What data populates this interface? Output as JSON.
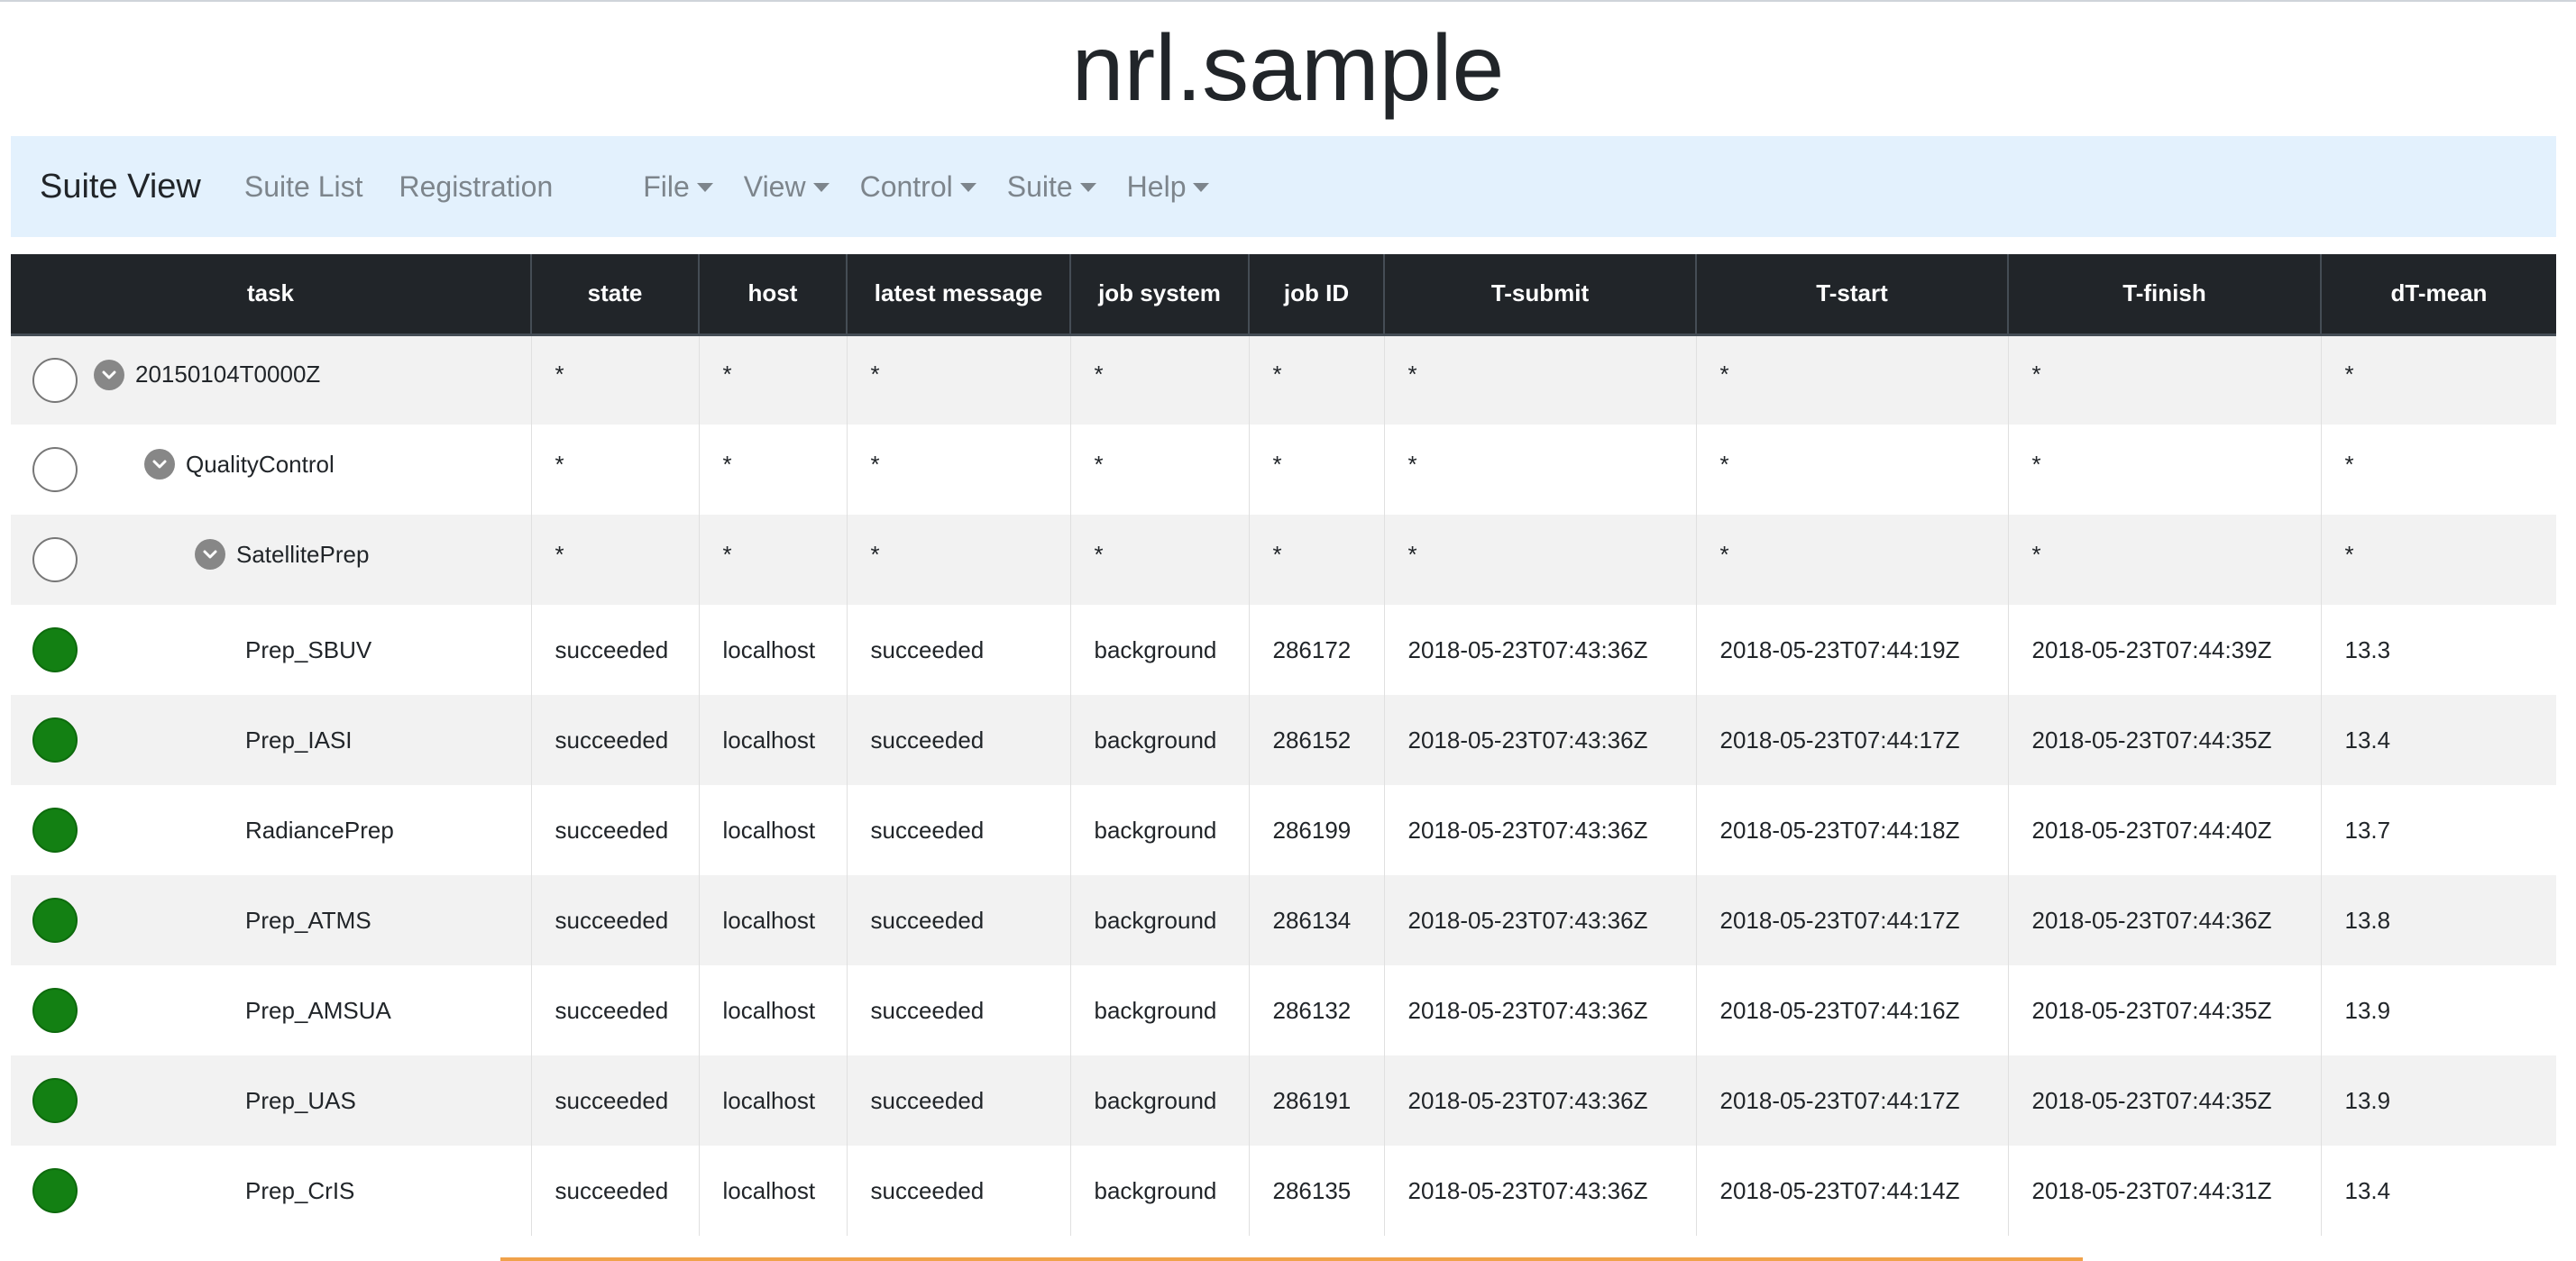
{
  "page": {
    "title": "nrl.sample"
  },
  "navbar": {
    "brand": "Suite View",
    "links": [
      "Suite List",
      "Registration"
    ],
    "menus": [
      "File",
      "View",
      "Control",
      "Suite",
      "Help"
    ]
  },
  "table": {
    "columns": [
      "task",
      "state",
      "host",
      "latest message",
      "job system",
      "job ID",
      "T-submit",
      "T-start",
      "T-finish",
      "dT-mean"
    ],
    "families": [
      {
        "name": "20150104T0000Z",
        "values": [
          "*",
          "*",
          "*",
          "*",
          "*",
          "*",
          "*",
          "*",
          "*"
        ]
      },
      {
        "name": "QualityControl",
        "values": [
          "*",
          "*",
          "*",
          "*",
          "*",
          "*",
          "*",
          "*",
          "*"
        ]
      },
      {
        "name": "SatellitePrep",
        "values": [
          "*",
          "*",
          "*",
          "*",
          "*",
          "*",
          "*",
          "*",
          "*"
        ]
      }
    ],
    "tasks": [
      {
        "name": "Prep_SBUV",
        "state": "succeeded",
        "host": "localhost",
        "message": "succeeded",
        "job_system": "background",
        "job_id": "286172",
        "t_submit": "2018-05-23T07:43:36Z",
        "t_start": "2018-05-23T07:44:19Z",
        "t_finish": "2018-05-23T07:44:39Z",
        "dt_mean": "13.3"
      },
      {
        "name": "Prep_IASI",
        "state": "succeeded",
        "host": "localhost",
        "message": "succeeded",
        "job_system": "background",
        "job_id": "286152",
        "t_submit": "2018-05-23T07:43:36Z",
        "t_start": "2018-05-23T07:44:17Z",
        "t_finish": "2018-05-23T07:44:35Z",
        "dt_mean": "13.4"
      },
      {
        "name": "RadiancePrep",
        "state": "succeeded",
        "host": "localhost",
        "message": "succeeded",
        "job_system": "background",
        "job_id": "286199",
        "t_submit": "2018-05-23T07:43:36Z",
        "t_start": "2018-05-23T07:44:18Z",
        "t_finish": "2018-05-23T07:44:40Z",
        "dt_mean": "13.7"
      },
      {
        "name": "Prep_ATMS",
        "state": "succeeded",
        "host": "localhost",
        "message": "succeeded",
        "job_system": "background",
        "job_id": "286134",
        "t_submit": "2018-05-23T07:43:36Z",
        "t_start": "2018-05-23T07:44:17Z",
        "t_finish": "2018-05-23T07:44:36Z",
        "dt_mean": "13.8"
      },
      {
        "name": "Prep_AMSUA",
        "state": "succeeded",
        "host": "localhost",
        "message": "succeeded",
        "job_system": "background",
        "job_id": "286132",
        "t_submit": "2018-05-23T07:43:36Z",
        "t_start": "2018-05-23T07:44:16Z",
        "t_finish": "2018-05-23T07:44:35Z",
        "dt_mean": "13.9"
      },
      {
        "name": "Prep_UAS",
        "state": "succeeded",
        "host": "localhost",
        "message": "succeeded",
        "job_system": "background",
        "job_id": "286191",
        "t_submit": "2018-05-23T07:43:36Z",
        "t_start": "2018-05-23T07:44:17Z",
        "t_finish": "2018-05-23T07:44:35Z",
        "dt_mean": "13.9"
      },
      {
        "name": "Prep_CrIS",
        "state": "succeeded",
        "host": "localhost",
        "message": "succeeded",
        "job_system": "background",
        "job_id": "286135",
        "t_submit": "2018-05-23T07:43:36Z",
        "t_start": "2018-05-23T07:44:14Z",
        "t_finish": "2018-05-23T07:44:31Z",
        "dt_mean": "13.4"
      }
    ]
  },
  "colors": {
    "succeeded": "#138013",
    "navbar_bg": "#e3f1fd",
    "header_bg": "#212529"
  },
  "icons": {
    "expanded": "chevron-down-icon"
  }
}
